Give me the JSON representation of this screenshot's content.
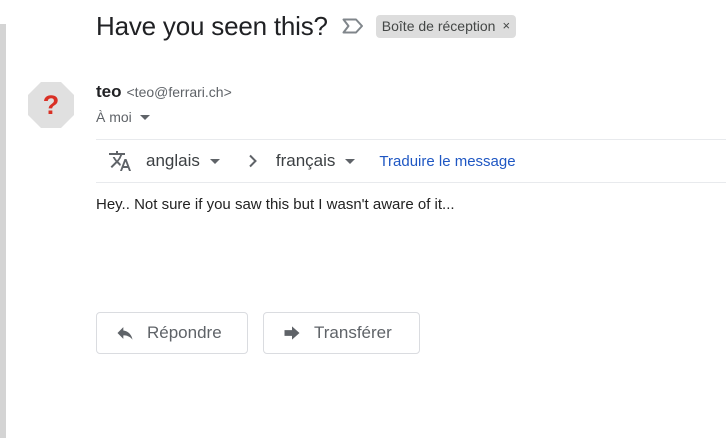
{
  "email": {
    "subject": "Have you seen this?",
    "label_chip": "Boîte de réception",
    "label_chip_close": "×",
    "sender_name": "teo",
    "sender_email": "<teo@ferrari.ch>",
    "recipient": "À moi",
    "body": "Hey.. Not sure if you saw this but I wasn't aware of it..."
  },
  "avatar": {
    "glyph": "?",
    "icon": "question-mark-icon",
    "color": "#d93025",
    "bg": "#e0e0e0"
  },
  "translate": {
    "source_language": "anglais",
    "target_language": "français",
    "translate_link": "Traduire le message",
    "link_color": "#1f57c3"
  },
  "actions": {
    "reply_label": "Répondre",
    "forward_label": "Transférer"
  }
}
